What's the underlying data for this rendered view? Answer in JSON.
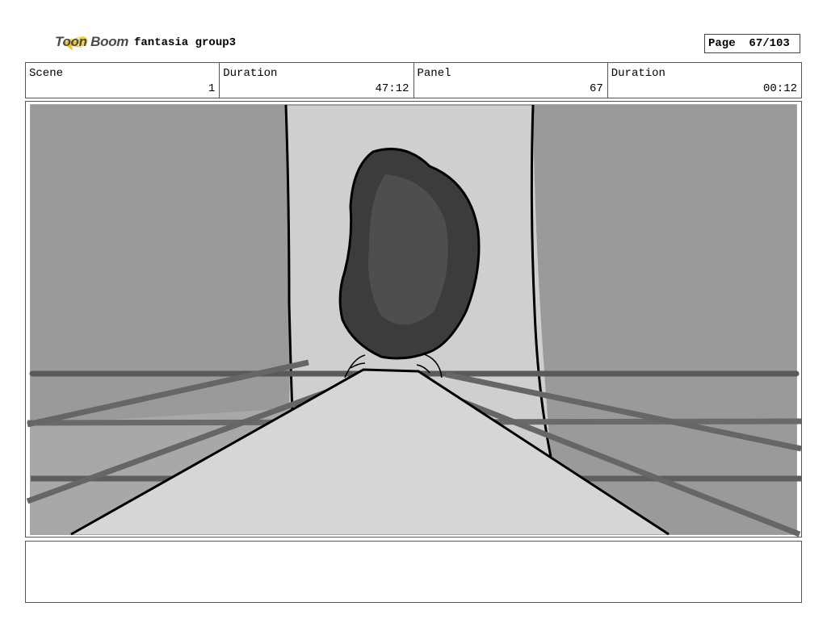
{
  "header": {
    "logo_text": "Toon Boom",
    "project_title": "fantasia group3",
    "page_label": "Page",
    "page_number": "67/103"
  },
  "info_row": [
    {
      "label": "Scene",
      "value": "1"
    },
    {
      "label": "Duration",
      "value": "47:12"
    },
    {
      "label": "Panel",
      "value": "67"
    },
    {
      "label": "Duration",
      "value": "00:12"
    }
  ],
  "panel": {
    "drawing_icon": "storyboard-sketch-corridor-with-rock"
  },
  "notes": {
    "text": ""
  },
  "colors": {
    "logo_yellow": "#f5c518",
    "logo_text": "#4a4a52",
    "wall_gray": "#9a9a9a",
    "corridor_light": "#cfcfcf",
    "rock_dark": "#3c3c3c"
  }
}
